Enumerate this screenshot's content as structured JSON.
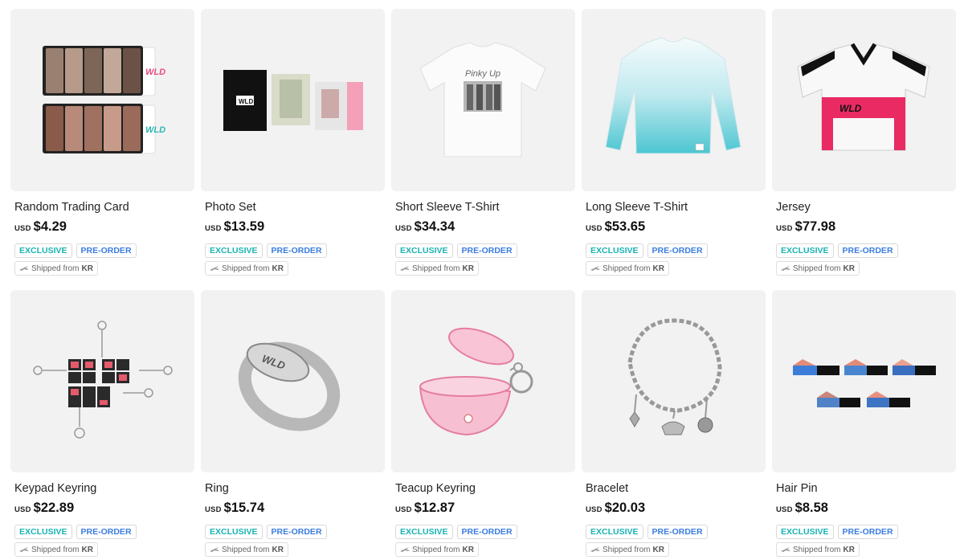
{
  "badges": {
    "exclusive": "EXCLUSIVE",
    "preorder": "PRE-ORDER"
  },
  "shipping": {
    "text": "Shipped from",
    "country": "KR"
  },
  "currency": "USD",
  "products": [
    {
      "name": "Random Trading Card",
      "price": "$4.29",
      "image": "trading-card-image"
    },
    {
      "name": "Photo Set",
      "price": "$13.59",
      "image": "photo-set-image"
    },
    {
      "name": "Short Sleeve T-Shirt",
      "price": "$34.34",
      "image": "short-sleeve-tshirt-image"
    },
    {
      "name": "Long Sleeve T-Shirt",
      "price": "$53.65",
      "image": "long-sleeve-tshirt-image"
    },
    {
      "name": "Jersey",
      "price": "$77.98",
      "image": "jersey-image"
    },
    {
      "name": "Keypad Keyring",
      "price": "$22.89",
      "image": "keypad-keyring-image"
    },
    {
      "name": "Ring",
      "price": "$15.74",
      "image": "ring-image"
    },
    {
      "name": "Teacup Keyring",
      "price": "$12.87",
      "image": "teacup-keyring-image"
    },
    {
      "name": "Bracelet",
      "price": "$20.03",
      "image": "bracelet-image"
    },
    {
      "name": "Hair Pin",
      "price": "$8.58",
      "image": "hair-pin-image"
    }
  ]
}
